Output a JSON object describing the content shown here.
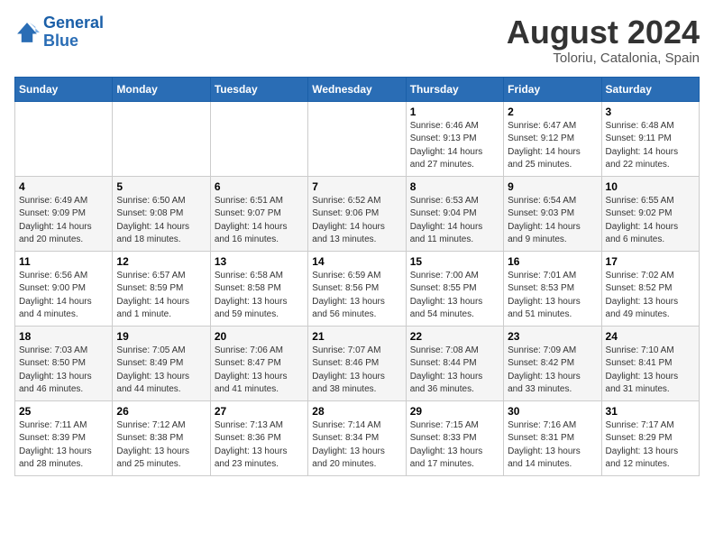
{
  "header": {
    "logo_line1": "General",
    "logo_line2": "Blue",
    "main_title": "August 2024",
    "subtitle": "Toloriu, Catalonia, Spain"
  },
  "columns": [
    "Sunday",
    "Monday",
    "Tuesday",
    "Wednesday",
    "Thursday",
    "Friday",
    "Saturday"
  ],
  "weeks": [
    [
      {
        "day": "",
        "info": ""
      },
      {
        "day": "",
        "info": ""
      },
      {
        "day": "",
        "info": ""
      },
      {
        "day": "",
        "info": ""
      },
      {
        "day": "1",
        "info": "Sunrise: 6:46 AM\nSunset: 9:13 PM\nDaylight: 14 hours and 27 minutes."
      },
      {
        "day": "2",
        "info": "Sunrise: 6:47 AM\nSunset: 9:12 PM\nDaylight: 14 hours and 25 minutes."
      },
      {
        "day": "3",
        "info": "Sunrise: 6:48 AM\nSunset: 9:11 PM\nDaylight: 14 hours and 22 minutes."
      }
    ],
    [
      {
        "day": "4",
        "info": "Sunrise: 6:49 AM\nSunset: 9:09 PM\nDaylight: 14 hours and 20 minutes."
      },
      {
        "day": "5",
        "info": "Sunrise: 6:50 AM\nSunset: 9:08 PM\nDaylight: 14 hours and 18 minutes."
      },
      {
        "day": "6",
        "info": "Sunrise: 6:51 AM\nSunset: 9:07 PM\nDaylight: 14 hours and 16 minutes."
      },
      {
        "day": "7",
        "info": "Sunrise: 6:52 AM\nSunset: 9:06 PM\nDaylight: 14 hours and 13 minutes."
      },
      {
        "day": "8",
        "info": "Sunrise: 6:53 AM\nSunset: 9:04 PM\nDaylight: 14 hours and 11 minutes."
      },
      {
        "day": "9",
        "info": "Sunrise: 6:54 AM\nSunset: 9:03 PM\nDaylight: 14 hours and 9 minutes."
      },
      {
        "day": "10",
        "info": "Sunrise: 6:55 AM\nSunset: 9:02 PM\nDaylight: 14 hours and 6 minutes."
      }
    ],
    [
      {
        "day": "11",
        "info": "Sunrise: 6:56 AM\nSunset: 9:00 PM\nDaylight: 14 hours and 4 minutes."
      },
      {
        "day": "12",
        "info": "Sunrise: 6:57 AM\nSunset: 8:59 PM\nDaylight: 14 hours and 1 minute."
      },
      {
        "day": "13",
        "info": "Sunrise: 6:58 AM\nSunset: 8:58 PM\nDaylight: 13 hours and 59 minutes."
      },
      {
        "day": "14",
        "info": "Sunrise: 6:59 AM\nSunset: 8:56 PM\nDaylight: 13 hours and 56 minutes."
      },
      {
        "day": "15",
        "info": "Sunrise: 7:00 AM\nSunset: 8:55 PM\nDaylight: 13 hours and 54 minutes."
      },
      {
        "day": "16",
        "info": "Sunrise: 7:01 AM\nSunset: 8:53 PM\nDaylight: 13 hours and 51 minutes."
      },
      {
        "day": "17",
        "info": "Sunrise: 7:02 AM\nSunset: 8:52 PM\nDaylight: 13 hours and 49 minutes."
      }
    ],
    [
      {
        "day": "18",
        "info": "Sunrise: 7:03 AM\nSunset: 8:50 PM\nDaylight: 13 hours and 46 minutes."
      },
      {
        "day": "19",
        "info": "Sunrise: 7:05 AM\nSunset: 8:49 PM\nDaylight: 13 hours and 44 minutes."
      },
      {
        "day": "20",
        "info": "Sunrise: 7:06 AM\nSunset: 8:47 PM\nDaylight: 13 hours and 41 minutes."
      },
      {
        "day": "21",
        "info": "Sunrise: 7:07 AM\nSunset: 8:46 PM\nDaylight: 13 hours and 38 minutes."
      },
      {
        "day": "22",
        "info": "Sunrise: 7:08 AM\nSunset: 8:44 PM\nDaylight: 13 hours and 36 minutes."
      },
      {
        "day": "23",
        "info": "Sunrise: 7:09 AM\nSunset: 8:42 PM\nDaylight: 13 hours and 33 minutes."
      },
      {
        "day": "24",
        "info": "Sunrise: 7:10 AM\nSunset: 8:41 PM\nDaylight: 13 hours and 31 minutes."
      }
    ],
    [
      {
        "day": "25",
        "info": "Sunrise: 7:11 AM\nSunset: 8:39 PM\nDaylight: 13 hours and 28 minutes."
      },
      {
        "day": "26",
        "info": "Sunrise: 7:12 AM\nSunset: 8:38 PM\nDaylight: 13 hours and 25 minutes."
      },
      {
        "day": "27",
        "info": "Sunrise: 7:13 AM\nSunset: 8:36 PM\nDaylight: 13 hours and 23 minutes."
      },
      {
        "day": "28",
        "info": "Sunrise: 7:14 AM\nSunset: 8:34 PM\nDaylight: 13 hours and 20 minutes."
      },
      {
        "day": "29",
        "info": "Sunrise: 7:15 AM\nSunset: 8:33 PM\nDaylight: 13 hours and 17 minutes."
      },
      {
        "day": "30",
        "info": "Sunrise: 7:16 AM\nSunset: 8:31 PM\nDaylight: 13 hours and 14 minutes."
      },
      {
        "day": "31",
        "info": "Sunrise: 7:17 AM\nSunset: 8:29 PM\nDaylight: 13 hours and 12 minutes."
      }
    ]
  ]
}
